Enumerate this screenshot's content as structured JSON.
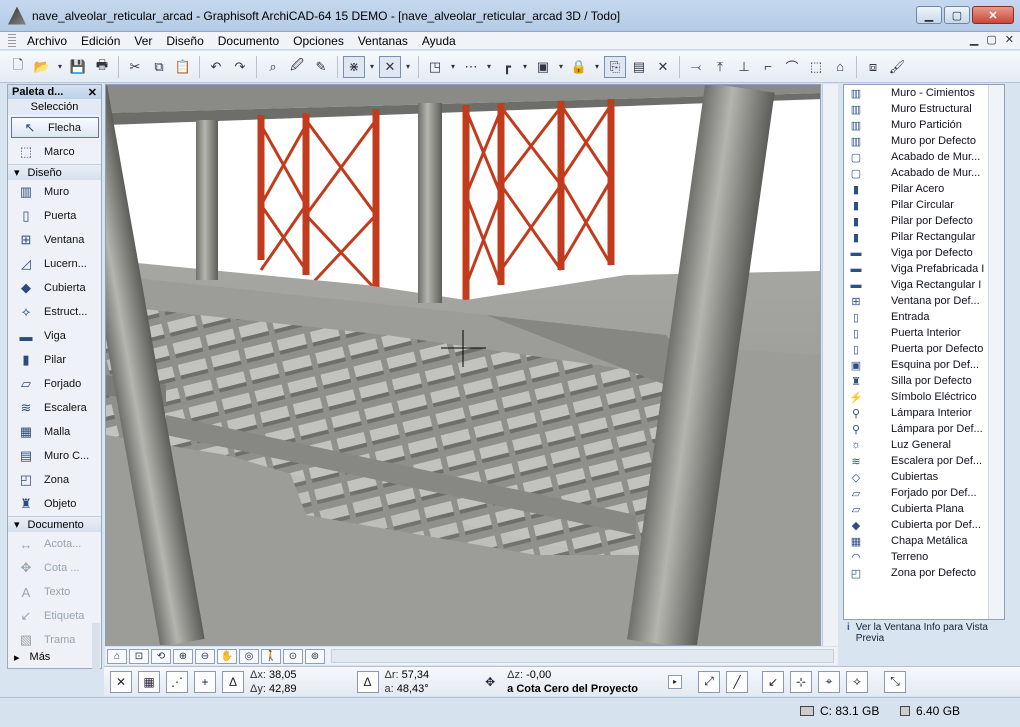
{
  "window": {
    "title": "nave_alveolar_reticular_arcad - Graphisoft ArchiCAD-64 15 DEMO - [nave_alveolar_reticular_arcad 3D / Todo]",
    "minimize": "▁",
    "maximize": "▢",
    "close": "✕"
  },
  "menu": [
    "Archivo",
    "Edición",
    "Ver",
    "Diseño",
    "Documento",
    "Opciones",
    "Ventanas",
    "Ayuda"
  ],
  "mdi_controls": [
    "▁",
    "▢",
    "✕"
  ],
  "palette": {
    "title": "Paleta d...",
    "close": "✕",
    "section_select": "Selección",
    "select_items": [
      {
        "label": "Flecha",
        "icon": "↖",
        "selected": true
      },
      {
        "label": "Marco",
        "icon": "⬚",
        "selected": false
      }
    ],
    "design_group": "Diseño",
    "design_items": [
      {
        "label": "Muro",
        "icon": "▥"
      },
      {
        "label": "Puerta",
        "icon": "▯"
      },
      {
        "label": "Ventana",
        "icon": "⊞"
      },
      {
        "label": "Lucern...",
        "icon": "◿"
      },
      {
        "label": "Cubierta",
        "icon": "◆"
      },
      {
        "label": "Estruct...",
        "icon": "⟡"
      },
      {
        "label": "Viga",
        "icon": "▬"
      },
      {
        "label": "Pilar",
        "icon": "▮"
      },
      {
        "label": "Forjado",
        "icon": "▱"
      },
      {
        "label": "Escalera",
        "icon": "≋"
      },
      {
        "label": "Malla",
        "icon": "▦"
      },
      {
        "label": "Muro C...",
        "icon": "▤"
      },
      {
        "label": "Zona",
        "icon": "◰"
      },
      {
        "label": "Objeto",
        "icon": "♜"
      }
    ],
    "document_group": "Documento",
    "document_items": [
      {
        "label": "Acota...",
        "icon": "↔"
      },
      {
        "label": "Cota ...",
        "icon": "✥"
      },
      {
        "label": "Texto",
        "icon": "A"
      },
      {
        "label": "Etiqueta",
        "icon": "↙"
      },
      {
        "label": "Trama",
        "icon": "▧"
      }
    ],
    "more": "Más"
  },
  "objects": [
    "Muro - Cimientos",
    "Muro Estructural",
    "Muro Partición",
    "Muro por Defecto",
    "Acabado de Mur...",
    "Acabado de Mur...",
    "Pilar Acero",
    "Pilar Circular",
    "Pilar por Defecto",
    "Pilar Rectangular",
    "Viga por Defecto",
    "Viga Prefabricada I",
    "Viga Rectangular I",
    "Ventana por Def...",
    "Entrada",
    "Puerta Interior",
    "Puerta por Defecto",
    "Esquina por Def...",
    "Silla por Defecto",
    "Símbolo Eléctrico",
    "Lámpara Interior",
    "Lámpara por Def...",
    "Luz General",
    "Escalera por Def...",
    "Cubiertas",
    "Forjado por Def...",
    "Cubierta Plana",
    "Cubierta por Def...",
    "Chapa Metálica",
    "Terreno",
    "Zona por Defecto"
  ],
  "object_info": "Ver la Ventana Info para Vista Previa",
  "coords": {
    "dx_label": "Δx:",
    "dx": "38,05",
    "dy_label": "Δy:",
    "dy": "42,89",
    "dr_label": "Δr:",
    "dr": "57,34",
    "a_label": "a:",
    "a": "48,43°",
    "dz_label": "Δz:",
    "dz": "-0,00",
    "ref": "a Cota Cero del Proyecto"
  },
  "status": {
    "disk": "C: 83.1 GB",
    "ram": "6.40 GB"
  },
  "colors": {
    "steel": "#c23b1d",
    "concrete": "#9a9a96",
    "accent": "#2b5ca8"
  }
}
